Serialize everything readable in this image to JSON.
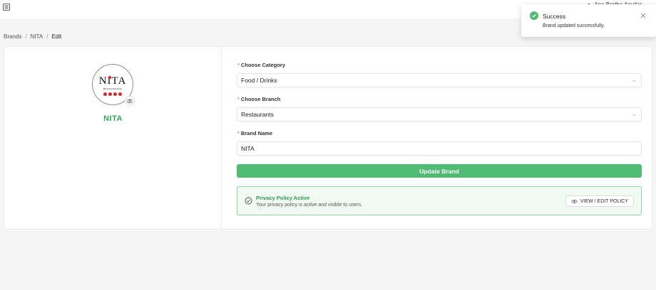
{
  "header": {
    "menu_icon": "menu-toggle-icon",
    "user_name": "Ana Bertha Aguilar"
  },
  "breadcrumb": {
    "items": [
      "Brands",
      "NITA",
      "Edit"
    ]
  },
  "brand": {
    "logo_word": "NITA",
    "logo_sub": "RESTAURANTE",
    "title": "NITA"
  },
  "form": {
    "category_label": "Choose Category",
    "category_value": "Food / Drinks",
    "branch_label": "Choose Branch",
    "branch_value": "Restaurants",
    "name_label": "Brand Name",
    "name_value": "NITA",
    "submit_label": "Update Brand"
  },
  "policy": {
    "title": "Privacy Policy Active",
    "description": "Your privacy policy is active and visible to users.",
    "button_label": "VIEW / EDIT POLICY"
  },
  "toast": {
    "title": "Success",
    "message": "Brand updated successfully."
  },
  "colors": {
    "accent": "#4fbb73",
    "brand_text": "#3aa55a",
    "required": "#e04040",
    "logo_red": "#d02b2b"
  }
}
